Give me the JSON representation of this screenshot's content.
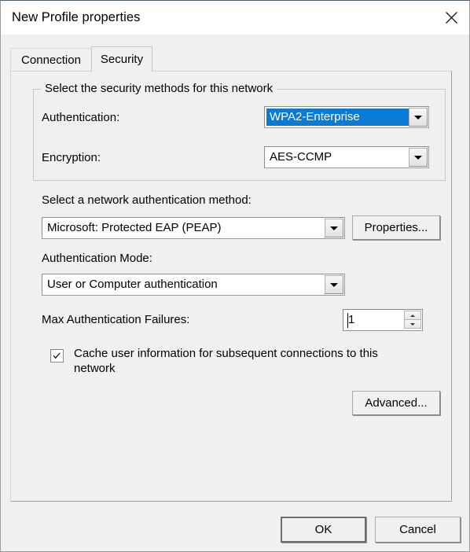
{
  "window": {
    "title": "New Profile properties",
    "close_icon": "close-icon"
  },
  "tabs": [
    {
      "label": "Connection",
      "active": false
    },
    {
      "label": "Security",
      "active": true
    }
  ],
  "security_group": {
    "legend": "Select the security methods for this network",
    "authentication": {
      "label": "Authentication:",
      "value": "WPA2-Enterprise",
      "selected": true
    },
    "encryption": {
      "label": "Encryption:",
      "value": "AES-CCMP",
      "selected": false
    }
  },
  "auth_method": {
    "label": "Select a network authentication method:",
    "value": "Microsoft: Protected EAP (PEAP)",
    "properties_button": "Properties..."
  },
  "auth_mode": {
    "label": "Authentication Mode:",
    "value": "User or Computer authentication"
  },
  "max_failures": {
    "label": "Max Authentication Failures:",
    "value": "1"
  },
  "cache_checkbox": {
    "label": "Cache user information for subsequent connections to this network",
    "checked": true,
    "check_glyph": "✔"
  },
  "advanced_button": {
    "label": "Advanced..."
  },
  "dialog_buttons": {
    "ok": "OK",
    "cancel": "Cancel"
  },
  "colors": {
    "highlight_blue": "#0a7ad4",
    "dialog_face": "#f0f0f0",
    "titlebar": "#ffffff",
    "text": "#000000"
  }
}
